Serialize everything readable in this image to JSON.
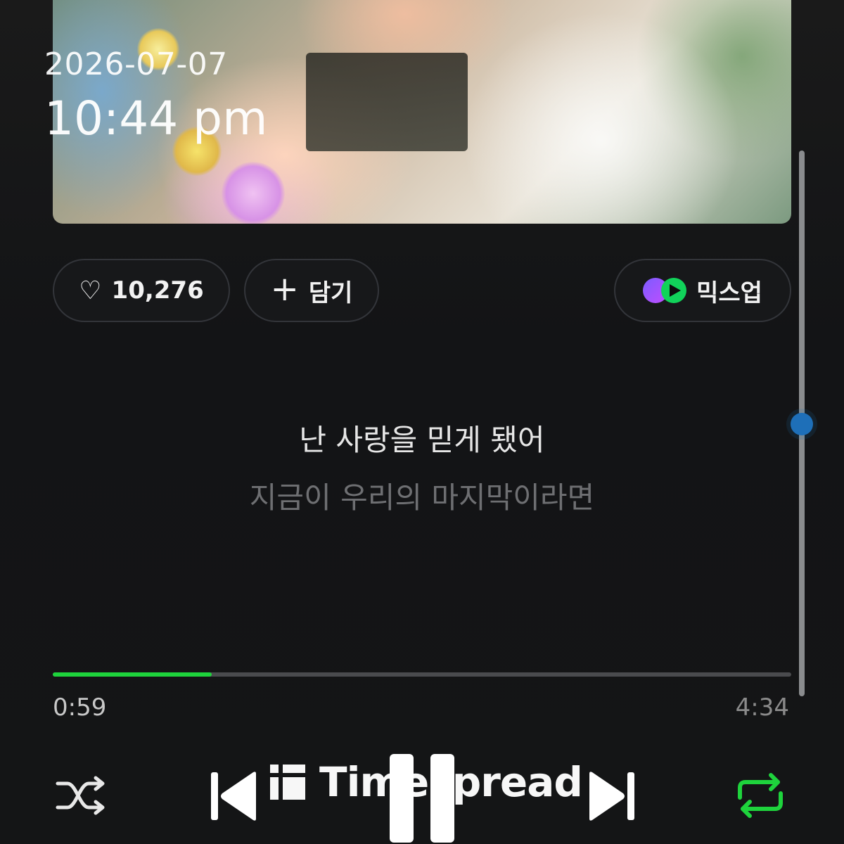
{
  "status": {
    "date": "2026-07-07",
    "time": "10:44 pm"
  },
  "actions": {
    "like_count": "10,276",
    "add_label": "담기",
    "mixup_label": "믹스업"
  },
  "lyrics": {
    "current": "난 사랑을 믿게 됐어",
    "next": "지금이 우리의 마지막이라면"
  },
  "playback": {
    "elapsed": "0:59",
    "duration": "4:34",
    "progress_fraction": 0.215
  },
  "watermark": {
    "text": "Timespread"
  },
  "colors": {
    "accent_green": "#1ed33c",
    "scroll_thumb": "#1e6fb8"
  },
  "icons": {
    "like": "heart-icon",
    "add": "plus-icon",
    "mixup": "mixup-icon",
    "shuffle": "shuffle-icon",
    "previous": "skip-previous-icon",
    "pause": "pause-icon",
    "next": "skip-next-icon",
    "repeat": "repeat-icon"
  }
}
